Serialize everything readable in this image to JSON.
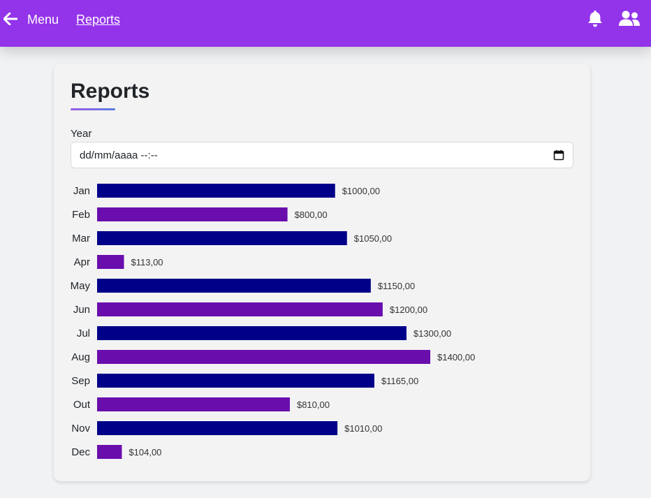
{
  "nav": {
    "menu_label": "Menu",
    "reports_label": "Reports",
    "back_icon": "arrow-left-icon",
    "bell_icon": "bell-icon",
    "users_icon": "users-icon",
    "bar_color": "#9333ea"
  },
  "card": {
    "title": "Reports",
    "year_label": "Year",
    "year_placeholder": "dd/mm/aaaa --:--"
  },
  "chart_data": {
    "type": "bar",
    "orientation": "horizontal",
    "categories": [
      "Jan",
      "Feb",
      "Mar",
      "Apr",
      "May",
      "Jun",
      "Jul",
      "Aug",
      "Sep",
      "Out",
      "Nov",
      "Dec"
    ],
    "values": [
      1000,
      800,
      1050,
      113,
      1150,
      1200,
      1300,
      1400,
      1165,
      810,
      1010,
      104
    ],
    "value_labels": [
      "$1000,00",
      "$800,00",
      "$1050,00",
      "$113,00",
      "$1150,00",
      "$1200,00",
      "$1300,00",
      "$1400,00",
      "$1165,00",
      "$810,00",
      "$1010,00",
      "$104,00"
    ],
    "colors": [
      "#000088",
      "#6a0dad"
    ],
    "title": "",
    "xlabel": "",
    "ylabel": ""
  }
}
